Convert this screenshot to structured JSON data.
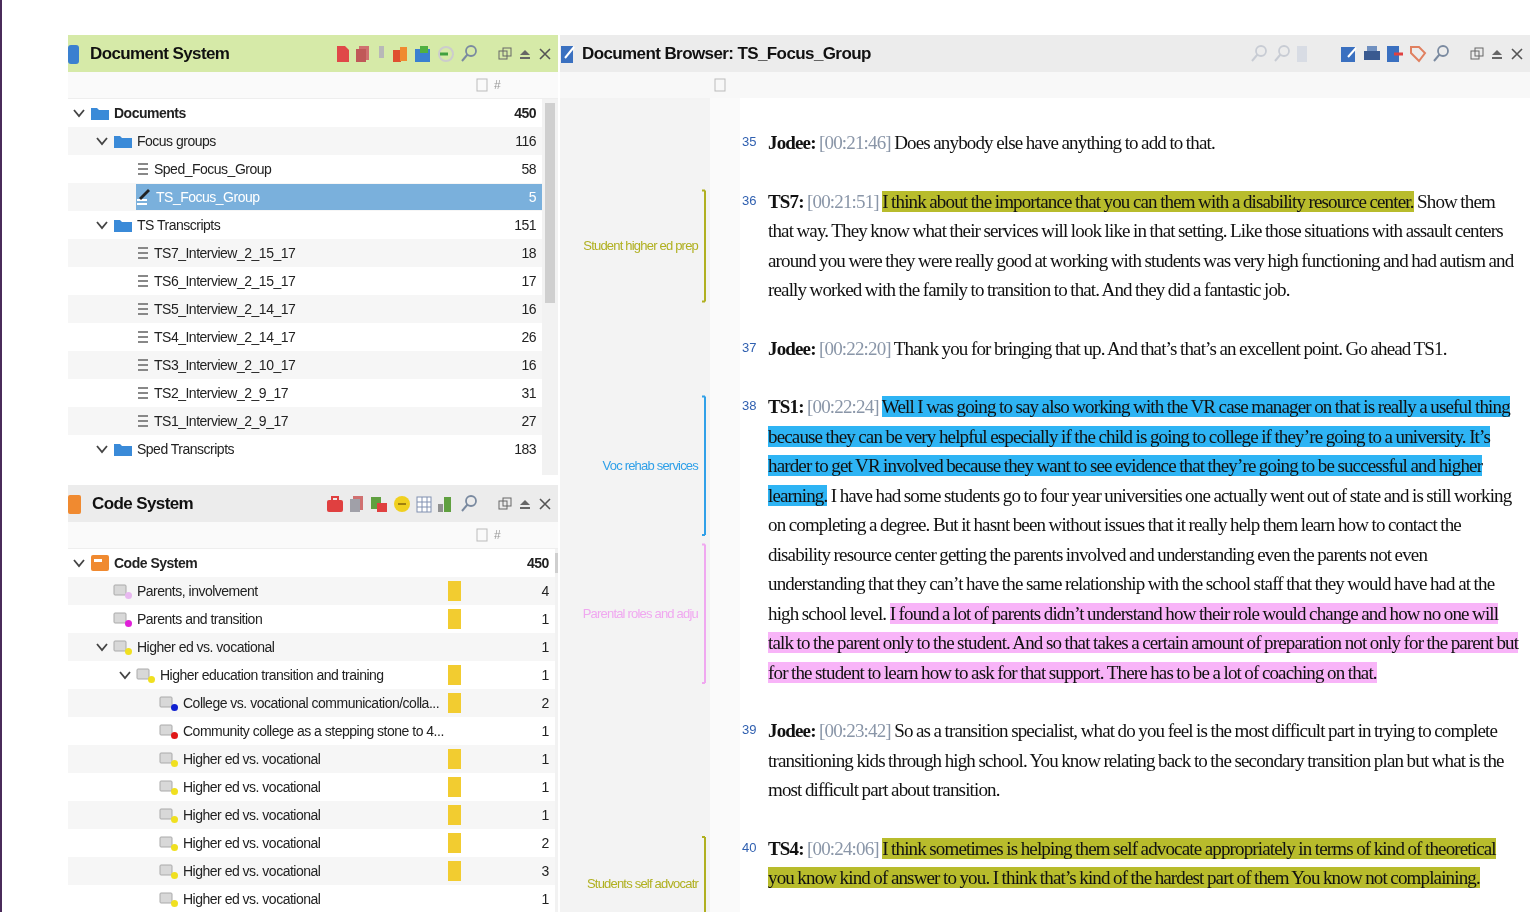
{
  "document_system": {
    "title": "Document System",
    "count_header": "#",
    "tree": [
      {
        "label": "Documents",
        "count": "450",
        "kind": "folder",
        "expanded": true,
        "selected": false,
        "children": [
          {
            "label": "Focus groups",
            "count": "116",
            "kind": "folder",
            "expanded": true,
            "selected": false,
            "children": [
              {
                "label": "Sped_Focus_Group",
                "count": "58",
                "kind": "document",
                "selected": false
              },
              {
                "label": "TS_Focus_Group",
                "count": "5",
                "kind": "open-document",
                "selected": true
              }
            ]
          },
          {
            "label": "TS Transcripts",
            "count": "151",
            "kind": "folder",
            "expanded": true,
            "selected": false,
            "children": [
              {
                "label": "TS7_Interview_2_15_17",
                "count": "18",
                "kind": "document",
                "selected": false
              },
              {
                "label": "TS6_Interview_2_15_17",
                "count": "17",
                "kind": "document",
                "selected": false
              },
              {
                "label": "TS5_Interview_2_14_17",
                "count": "16",
                "kind": "document",
                "selected": false
              },
              {
                "label": "TS4_Interview_2_14_17",
                "count": "26",
                "kind": "document",
                "selected": false
              },
              {
                "label": "TS3_Interview_2_10_17",
                "count": "16",
                "kind": "document",
                "selected": false
              },
              {
                "label": "TS2_Interview_2_9_17",
                "count": "31",
                "kind": "document",
                "selected": false
              },
              {
                "label": "TS1_Interview_2_9_17",
                "count": "27",
                "kind": "document",
                "selected": false
              }
            ]
          },
          {
            "label": "Sped Transcripts",
            "count": "183",
            "kind": "folder",
            "expanded": true,
            "selected": false
          }
        ]
      }
    ]
  },
  "code_system": {
    "title": "Code System",
    "count_header": "#",
    "tree": [
      {
        "label": "Code System",
        "count": "450",
        "kind": "root",
        "expanded": true,
        "selected": false,
        "children": [
          {
            "label": "Parents, involvement",
            "count": "4",
            "kind": "code",
            "color": "#e8b8f0",
            "swatch": true,
            "selected": false
          },
          {
            "label": "Parents and transition",
            "count": "1",
            "kind": "code",
            "color": "#e020d8",
            "swatch": true,
            "selected": false
          },
          {
            "label": "Higher ed vs. vocational",
            "count": "1",
            "kind": "code",
            "color": "#f0e020",
            "swatch": false,
            "expanded": true,
            "selected": false,
            "children": [
              {
                "label": "Higher education transition and training",
                "count": "1",
                "kind": "code",
                "color": "#f0e020",
                "swatch": true,
                "expanded": true,
                "selected": false,
                "children": [
                  {
                    "label": "College vs. vocational communication/colla...",
                    "count": "2",
                    "kind": "code",
                    "color": "#1020d0",
                    "swatch": true,
                    "selected": false
                  },
                  {
                    "label": "Community college as a stepping stone to 4...",
                    "count": "1",
                    "kind": "code",
                    "color": "#e01818",
                    "swatch": false,
                    "selected": false
                  },
                  {
                    "label": "Higher ed vs. vocational",
                    "count": "1",
                    "kind": "code",
                    "color": "#f0e020",
                    "swatch": true,
                    "selected": false
                  },
                  {
                    "label": "Higher ed vs. vocational",
                    "count": "1",
                    "kind": "code",
                    "color": "#f0e020",
                    "swatch": true,
                    "selected": false
                  },
                  {
                    "label": "Higher ed vs. vocational",
                    "count": "1",
                    "kind": "code",
                    "color": "#f0e020",
                    "swatch": true,
                    "selected": false
                  },
                  {
                    "label": "Higher ed vs. vocational",
                    "count": "2",
                    "kind": "code",
                    "color": "#f0e020",
                    "swatch": true,
                    "selected": false
                  },
                  {
                    "label": "Higher ed vs. vocational",
                    "count": "3",
                    "kind": "code",
                    "color": "#f0e020",
                    "swatch": true,
                    "selected": false
                  },
                  {
                    "label": "Higher ed vs. vocational",
                    "count": "1",
                    "kind": "code",
                    "color": "#f0e020",
                    "swatch": false,
                    "selected": false
                  }
                ]
              }
            ]
          }
        ]
      }
    ]
  },
  "document_browser": {
    "title": "Document Browser: TS_Focus_Group",
    "paragraphs": [
      {
        "number": "35",
        "speaker": "Jodee:",
        "time": "[00:21:46]",
        "segments": [
          {
            "text": "Does anybody else have anything to add to that."
          }
        ]
      },
      {
        "number": "36",
        "speaker": "TS7:",
        "time": "[00:21:51]",
        "codes": [
          {
            "label": "Student higher ed prep",
            "color": "#b0b020"
          }
        ],
        "segments": [
          {
            "text": "I think about the importance that you can them with a disability resource center.",
            "color": "#b8bc2c"
          },
          {
            "text": " Show them that way. They know what their services will look like in that setting. Like those situations with assault centers around you were they were really good at working with students was very high functioning and had autism and really worked with the family to transition to that. And they did a fantastic job."
          }
        ]
      },
      {
        "number": "37",
        "speaker": "Jodee:",
        "time": "[00:22:20]",
        "segments": [
          {
            "text": "Thank you for bringing that up. And that’s that’s an excellent point. Go ahead TS1."
          }
        ]
      },
      {
        "number": "38",
        "speaker": "TS1:",
        "time": "[00:22:24]",
        "codes": [
          {
            "label": "Voc rehab services",
            "color": "#30a0e8"
          },
          {
            "label": "Parental roles and adju",
            "color": "#f0a8f0"
          }
        ],
        "segments": [
          {
            "text": "Well I was going to say also working with the VR case manager on that is really a useful thing because they can be very helpful especially if the child is going to college if they’re going to a university. It’s harder to get VR involved because they want to see evidence that they’re going to be successful and higher learning.",
            "color": "#2eb4f4"
          },
          {
            "text": " I have had some students go to four year universities one actually went out of state and is still working on completing a degree. But it hasnt been without issues that it really help them learn how to contact the disability resource center getting the parents involved and understanding even the parents not even understanding that they can’t have the same relationship with the school staff that they would have had at the high school level. "
          },
          {
            "text": "I found a lot of parents didn’t understand how their role would change and how no one will talk to the parent only to the student. And so that takes a certain amount of preparation not only for the parent but for the student to learn how to ask for that support. There has to be a lot of coaching on that.",
            "color": "#f8b4f8"
          }
        ]
      },
      {
        "number": "39",
        "speaker": "Jodee:",
        "time": "[00:23:42]",
        "segments": [
          {
            "text": "So as a transition specialist, what do you feel is the most difficult part in trying to complete transitioning kids through high school. You know relating back to the secondary transition plan but what is the most difficult part about transition."
          }
        ]
      },
      {
        "number": "40",
        "speaker": "TS4:",
        "time": "[00:24:06]",
        "codes": [
          {
            "label": "Students self advocatr",
            "color": "#b0b020"
          }
        ],
        "segments": [
          {
            "text": "I think sometimes is helping them self advocate appropriately in terms of kind of theoretical you know kind of answer to you. I think that’s kind of the hardest part of them You know not complaining.",
            "color": "#b8bc2c"
          }
        ]
      }
    ]
  }
}
